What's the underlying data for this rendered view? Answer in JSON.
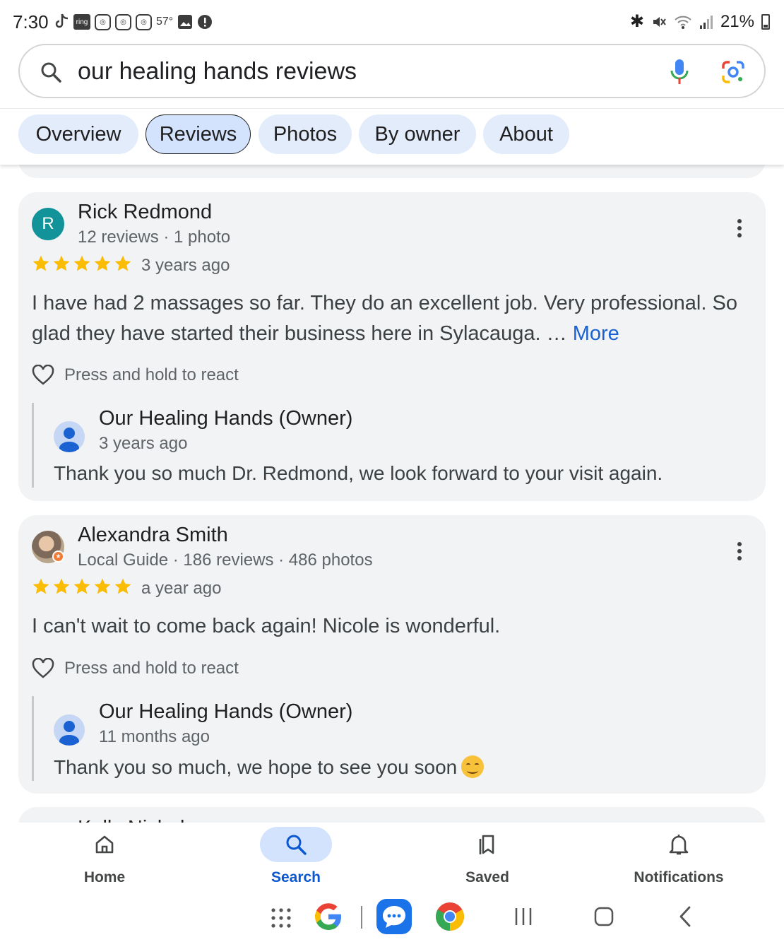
{
  "status_bar": {
    "time": "7:30",
    "ring_label": "ring",
    "temperature": "57°",
    "battery": "21%"
  },
  "search": {
    "query": "our healing hands reviews"
  },
  "tabs": [
    {
      "label": "Overview"
    },
    {
      "label": "Reviews"
    },
    {
      "label": "Photos"
    },
    {
      "label": "By owner"
    },
    {
      "label": "About"
    }
  ],
  "reviews": [
    {
      "avatar_letter": "R",
      "name": "Rick Redmond",
      "meta": "12 reviews · 1 photo",
      "rating": 5,
      "time": "3 years ago",
      "text": "I have had 2 massages so far. They do an excellent job. Very professional. So glad they have started their business here in Sylacauga. … ",
      "more": "More",
      "react": "Press and hold to react",
      "owner": {
        "name": "Our Healing Hands (Owner)",
        "time": "3 years ago",
        "text": "Thank you so much Dr. Redmond, we look forward to your visit again."
      }
    },
    {
      "name": "Alexandra Smith",
      "meta": "Local Guide · 186 reviews · 486 photos",
      "rating": 5,
      "time": "a year ago",
      "text": "I can't wait to come back again! Nicole is wonderful.",
      "react": "Press and hold to react",
      "owner": {
        "name": "Our Healing Hands (Owner)",
        "time": "11 months ago",
        "text": "Thank you so much, we hope to see you soon"
      }
    }
  ],
  "next_review_name": "Kelly Nichols",
  "bottom_nav": [
    {
      "label": "Home",
      "icon": "home-icon"
    },
    {
      "label": "Search",
      "icon": "search-icon"
    },
    {
      "label": "Saved",
      "icon": "saved-icon"
    },
    {
      "label": "Notifications",
      "icon": "bell-icon"
    }
  ],
  "colors": {
    "accent": "#0b57d0",
    "star": "#fbbc04",
    "card_bg": "#f1f3f4",
    "tab_bg": "#e3ecfb",
    "link": "#1a62d2"
  }
}
